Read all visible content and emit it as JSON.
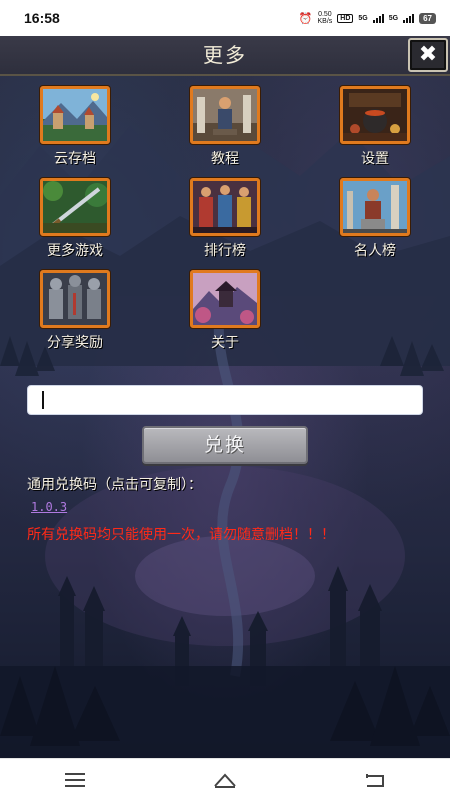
{
  "status_bar": {
    "time": "16:58",
    "alarm_icon": "alarm-icon",
    "net_speed_value": "0.50",
    "net_speed_unit": "KB/s",
    "hd_badge": "HD",
    "network_1": "5G",
    "network_2": "5G",
    "battery": "67"
  },
  "header": {
    "title": "更多",
    "close_icon": "close-icon"
  },
  "menu": {
    "items": [
      {
        "label": "云存档",
        "icon": "cloud-save-icon"
      },
      {
        "label": "教程",
        "icon": "tutorial-icon"
      },
      {
        "label": "设置",
        "icon": "settings-icon"
      },
      {
        "label": "更多游戏",
        "icon": "more-games-icon"
      },
      {
        "label": "排行榜",
        "icon": "leaderboard-icon"
      },
      {
        "label": "名人榜",
        "icon": "hall-of-fame-icon"
      },
      {
        "label": "分享奖励",
        "icon": "share-reward-icon"
      },
      {
        "label": "关于",
        "icon": "about-icon"
      }
    ]
  },
  "redeem": {
    "input_value": "",
    "button_label": "兑换",
    "codes_title": "通用兑换码（点击可复制）：",
    "code": "1.0.3",
    "warning": "所有兑换码均只能使用一次，请勿随意删档！！！"
  },
  "nav_bar": {
    "menu_icon": "menu-icon",
    "home_icon": "home-icon",
    "back_icon": "back-icon"
  },
  "colors": {
    "tile_border": "#e07a1e",
    "warning_text": "#ff2a18",
    "code_link": "#b07ae0"
  }
}
